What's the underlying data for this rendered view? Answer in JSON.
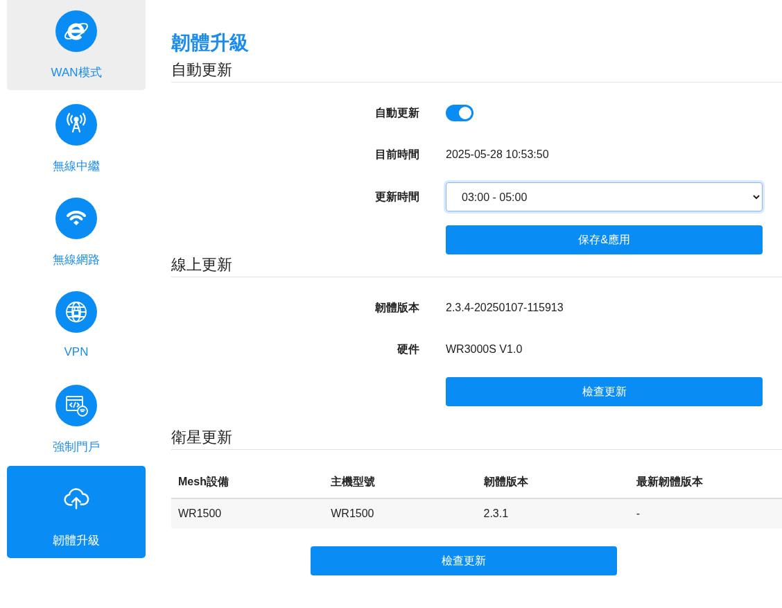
{
  "sidebar": {
    "items": [
      {
        "label": "WAN模式",
        "selected": false,
        "hovered": true
      },
      {
        "label": "無線中繼",
        "selected": false,
        "hovered": false
      },
      {
        "label": "無線網路",
        "selected": false,
        "hovered": false
      },
      {
        "label": "VPN",
        "selected": false,
        "hovered": false
      },
      {
        "label": "強制門戶",
        "selected": false,
        "hovered": false
      },
      {
        "label": "韌體升級",
        "selected": true,
        "hovered": false
      }
    ]
  },
  "page_title": "韌體升級",
  "auto_update": {
    "heading": "自動更新",
    "rows": [
      {
        "kind": "toggle",
        "label": "自動更新",
        "on": true
      },
      {
        "kind": "text",
        "label": "目前時間",
        "value": "2025-05-28 10:53:50"
      },
      {
        "kind": "select",
        "label": "更新時間",
        "value": "03:00 - 05:00"
      }
    ],
    "button": "保存&應用"
  },
  "online_update": {
    "heading": "線上更新",
    "rows": [
      {
        "kind": "text",
        "label": "韌體版本",
        "value": "2.3.4-20250107-115913"
      },
      {
        "kind": "text",
        "label": "硬件",
        "value": "WR3000S V1.0"
      }
    ],
    "button": "檢查更新"
  },
  "satellite_update": {
    "heading": "衛星更新",
    "table": {
      "columns": [
        "Mesh設備",
        "主機型號",
        "韌體版本",
        "最新韌體版本"
      ],
      "rows": [
        [
          "WR1500",
          "WR1500",
          "2.3.1",
          "-"
        ]
      ]
    },
    "button": "檢查更新"
  }
}
